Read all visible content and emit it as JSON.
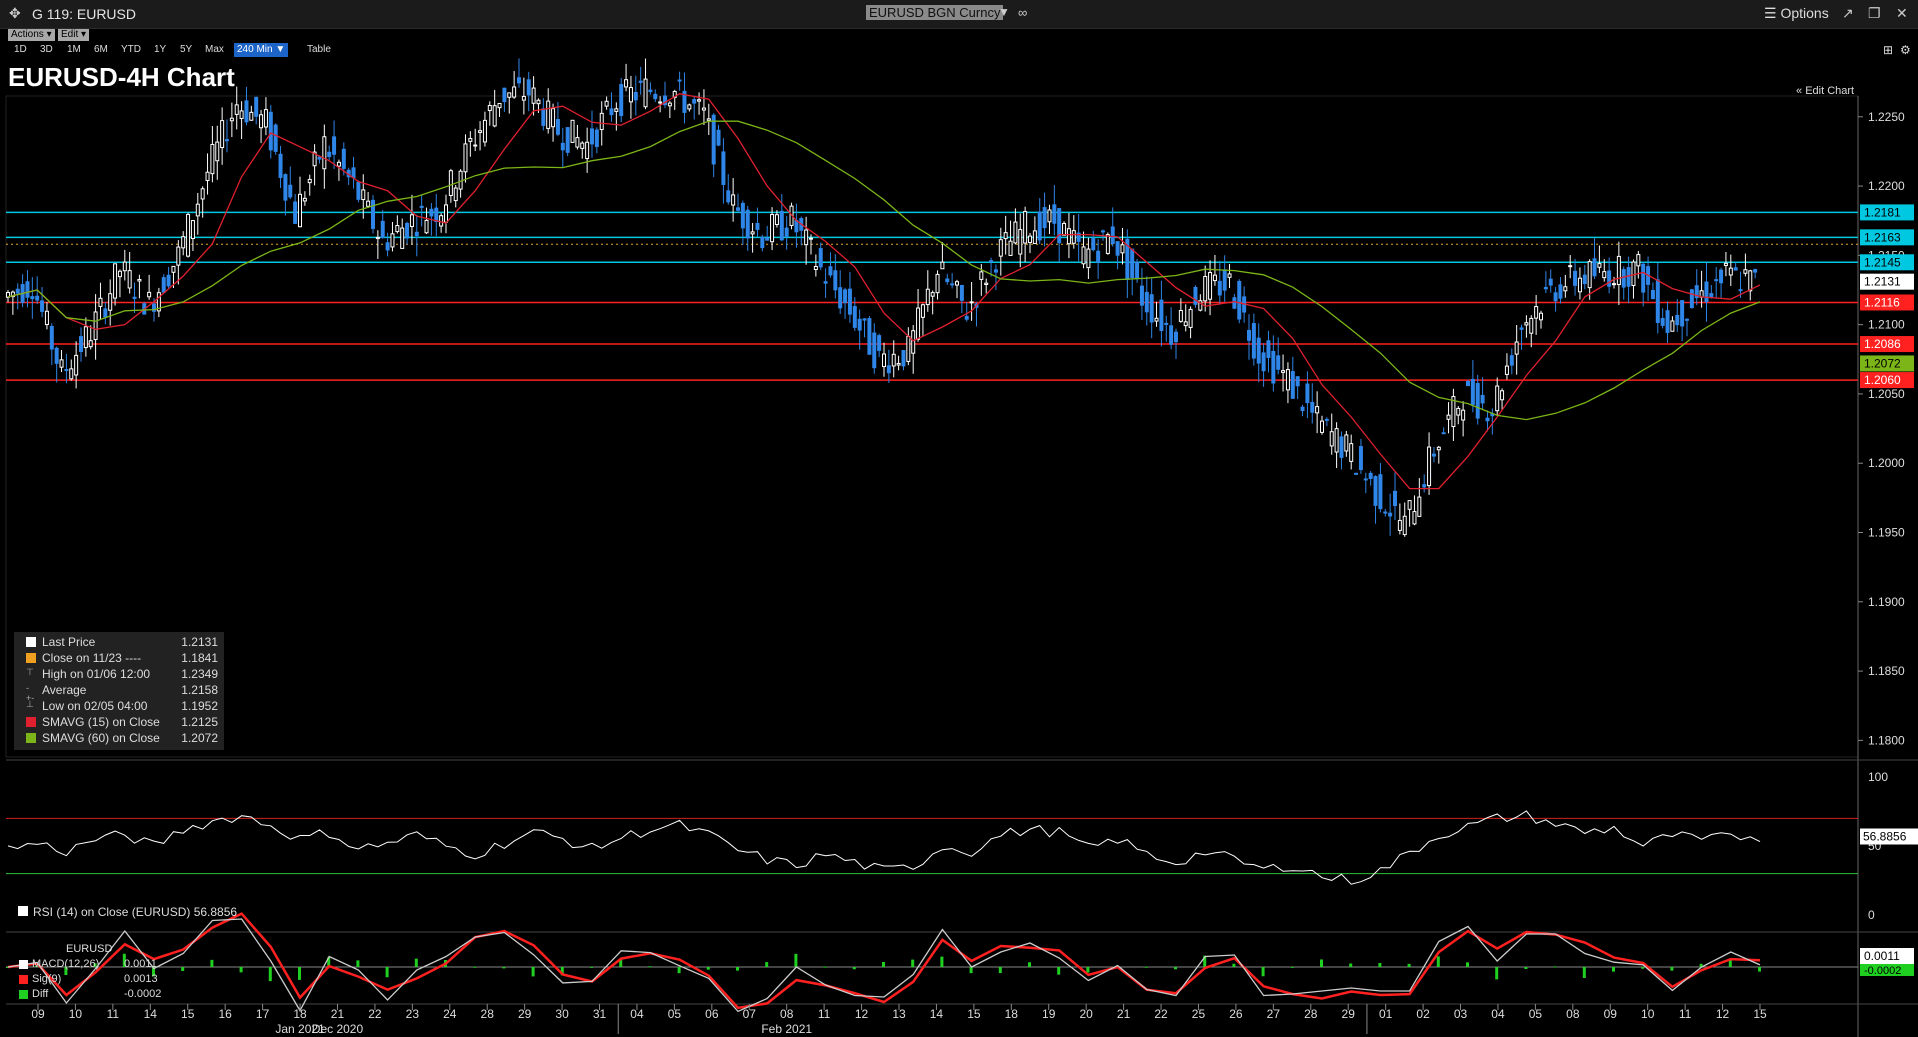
{
  "window": {
    "title": "G 119: EURUSD",
    "security": "EURUSD BGN Curncy",
    "options_label": "Options"
  },
  "menu": {
    "actions_label": "Actions ▾",
    "edit_label": "Edit ▾"
  },
  "ranges": [
    "1D",
    "3D",
    "1M",
    "6M",
    "YTD",
    "1Y",
    "5Y",
    "Max",
    "240 Min ▼"
  ],
  "active_range": "240 Min ▼",
  "table_label": "Table",
  "edit_chart_label": "Edit Chart",
  "chart_title": "EURUSD-4H Chart",
  "colors": {
    "up_candle": "#ffffff",
    "down_candle": "#2f86e8",
    "sma15": "#e0202f",
    "sma60": "#7cb518",
    "support": "#ff2020",
    "resistance": "#00c8e0",
    "average_line": "#e3a52a"
  },
  "legend": [
    {
      "color": "#ffffff",
      "label": "Last Price",
      "value": "1.2131"
    },
    {
      "color": "#f0a020",
      "label": "Close on 11/23 ----",
      "value": "1.1841"
    },
    {
      "color": "",
      "label": "High on 01/06 12:00",
      "value": "1.2349",
      "icon": "⊤"
    },
    {
      "color": "",
      "label": "Average",
      "value": "1.2158",
      "icon": "-+-"
    },
    {
      "color": "",
      "label": "Low on 02/05 04:00",
      "value": "1.1952",
      "icon": "⊥"
    },
    {
      "color": "#e0202f",
      "label": "SMAVG (15)  on Close",
      "value": "1.2125"
    },
    {
      "color": "#7cb518",
      "label": "SMAVG (60)  on Close",
      "value": "1.2072"
    }
  ],
  "rsi_legend": "RSI (14)  on Close (EURUSD) 56.8856",
  "rsi_value": "56.8856",
  "rsi_axis": [
    "100",
    "50",
    "0"
  ],
  "macd_title": "EURUSD",
  "macd_legend": [
    {
      "color": "#ffffff",
      "label": "MACD(12,26)",
      "value": "0.0011"
    },
    {
      "color": "#ff2020",
      "label": "Sig(9)",
      "value": "0.0013"
    },
    {
      "color": "#20d020",
      "label": "Diff",
      "value": "-0.0002"
    }
  ],
  "macd_value_label": "0.0011",
  "macd_diff_label": "-0.0002",
  "chart_data": {
    "type": "candlestick",
    "title": "EURUSD-4H Chart",
    "y_ticks": [
      1.225,
      1.22,
      1.215,
      1.21,
      1.205,
      1.2,
      1.195,
      1.19,
      1.185,
      1.18
    ],
    "y_tick_labels": [
      "1.2250",
      "1.2200",
      "1.2150",
      "1.2100",
      "1.2050",
      "1.2000",
      "1.1950",
      "1.1900",
      "1.1850",
      "1.1800"
    ],
    "ylim": [
      1.1788,
      1.2265
    ],
    "x_ticks": [
      "09",
      "10",
      "11",
      "14",
      "15",
      "16",
      "17",
      "18",
      "21",
      "22",
      "23",
      "24",
      "28",
      "29",
      "30",
      "31",
      "04",
      "05",
      "06",
      "07",
      "08",
      "11",
      "12",
      "13",
      "14",
      "15",
      "18",
      "19",
      "20",
      "21",
      "22",
      "25",
      "26",
      "27",
      "28",
      "29",
      "01",
      "02",
      "03",
      "04",
      "05",
      "08",
      "09",
      "10",
      "11",
      "12",
      "15"
    ],
    "month_labels": [
      {
        "label": "Dec 2020",
        "tick": "21"
      },
      {
        "label": "Jan 2021",
        "tick": "18"
      },
      {
        "label": "Feb 2021",
        "tick": "08"
      }
    ],
    "horizontal_levels": [
      {
        "value": 1.2181,
        "label": "1.2181",
        "kind": "resistance"
      },
      {
        "value": 1.2163,
        "label": "1.2163",
        "kind": "resistance"
      },
      {
        "value": 1.2145,
        "label": "1.2145",
        "kind": "resistance"
      },
      {
        "value": 1.2116,
        "label": "1.2116",
        "kind": "support"
      },
      {
        "value": 1.2086,
        "label": "1.2086",
        "kind": "support"
      },
      {
        "value": 1.206,
        "label": "1.2060",
        "kind": "support"
      }
    ],
    "average_level": 1.2158,
    "last_price": 1.2131,
    "sma15_last": 1.2125,
    "sma60_last": 1.2072,
    "close_path": [
      [
        0,
        1.212
      ],
      [
        1,
        1.213
      ],
      [
        2,
        1.2065
      ],
      [
        3,
        1.2095
      ],
      [
        4,
        1.214
      ],
      [
        5,
        1.2115
      ],
      [
        6,
        1.215
      ],
      [
        7,
        1.221
      ],
      [
        8,
        1.226
      ],
      [
        9,
        1.2245
      ],
      [
        10,
        1.218
      ],
      [
        11,
        1.223
      ],
      [
        12,
        1.22
      ],
      [
        13,
        1.216
      ],
      [
        14,
        1.2175
      ],
      [
        15,
        1.2185
      ],
      [
        16,
        1.223
      ],
      [
        17,
        1.2265
      ],
      [
        18,
        1.2268
      ],
      [
        19,
        1.224
      ],
      [
        20,
        1.223
      ],
      [
        21,
        1.2262
      ],
      [
        22,
        1.227
      ],
      [
        23,
        1.2268
      ],
      [
        24,
        1.225
      ],
      [
        25,
        1.2185
      ],
      [
        26,
        1.2165
      ],
      [
        27,
        1.2175
      ],
      [
        28,
        1.214
      ],
      [
        29,
        1.211
      ],
      [
        30,
        1.2075
      ],
      [
        31,
        1.208
      ],
      [
        32,
        1.214
      ],
      [
        33,
        1.211
      ],
      [
        34,
        1.215
      ],
      [
        35,
        1.217
      ],
      [
        36,
        1.2175
      ],
      [
        37,
        1.215
      ],
      [
        38,
        1.2165
      ],
      [
        39,
        1.212
      ],
      [
        40,
        1.2095
      ],
      [
        41,
        1.2125
      ],
      [
        42,
        1.213
      ],
      [
        43,
        1.208
      ],
      [
        44,
        1.206
      ],
      [
        45,
        1.203
      ],
      [
        46,
        1.201
      ],
      [
        47,
        1.198
      ],
      [
        48,
        1.1955
      ],
      [
        49,
        1.201
      ],
      [
        50,
        1.205
      ],
      [
        51,
        1.204
      ],
      [
        52,
        1.21
      ],
      [
        53,
        1.2125
      ],
      [
        54,
        1.2135
      ],
      [
        55,
        1.2138
      ],
      [
        56,
        1.214
      ],
      [
        57,
        1.21
      ],
      [
        58,
        1.212
      ],
      [
        59,
        1.2135
      ],
      [
        60,
        1.2131
      ]
    ],
    "rsi_ylim": [
      0,
      100
    ],
    "rsi_levels": [
      70,
      30
    ],
    "rsi_last": 56.8856,
    "rsi_path": [
      48,
      52,
      46,
      55,
      58,
      50,
      62,
      68,
      72,
      65,
      55,
      60,
      48,
      52,
      58,
      50,
      44,
      52,
      60,
      55,
      48,
      56,
      62,
      65,
      58,
      47,
      40,
      36,
      44,
      38,
      32,
      35,
      50,
      46,
      58,
      62,
      60,
      48,
      55,
      44,
      38,
      46,
      40,
      33,
      36,
      28,
      25,
      32,
      45,
      58,
      64,
      70,
      72,
      66,
      60,
      63,
      50,
      58,
      54,
      57,
      56.9
    ],
    "macd_ylim": [
      -0.003,
      0.003
    ],
    "macd_last": 0.0011,
    "signal_last": 0.0013,
    "diff_last": -0.0002
  }
}
